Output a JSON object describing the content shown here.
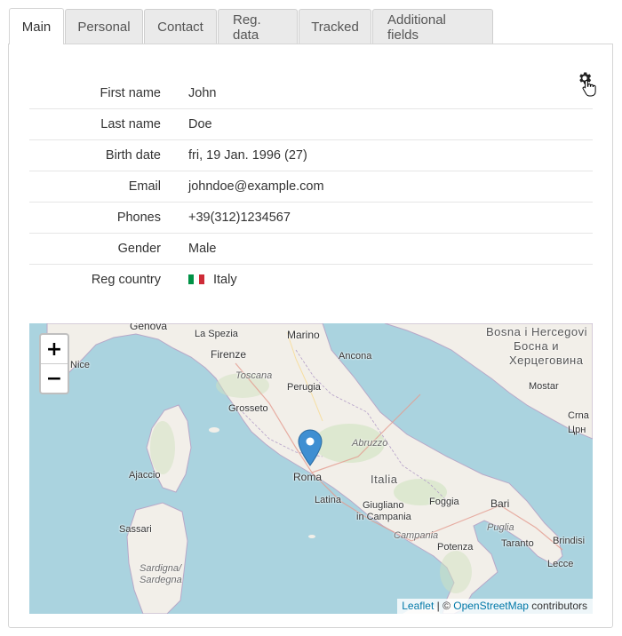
{
  "tabs": [
    "Main",
    "Personal",
    "Contact",
    "Reg. data",
    "Tracked",
    "Additional fields"
  ],
  "fields": [
    {
      "label": "First name",
      "value": "John"
    },
    {
      "label": "Last name",
      "value": "Doe"
    },
    {
      "label": "Birth date",
      "value": "fri, 19 Jan. 1996 (27)"
    },
    {
      "label": "Email",
      "value": "johndoe@example.com"
    },
    {
      "label": "Phones",
      "value": "+39(312)1234567"
    },
    {
      "label": "Gender",
      "value": "Male"
    },
    {
      "label": "Reg country",
      "value": "Italy"
    }
  ],
  "flag_colors": [
    "#009246",
    "#ffffff",
    "#ce2b37"
  ],
  "icons": {
    "settings": "gear-icon",
    "cursor": "hand-pointer-icon",
    "marker": "map-marker-icon"
  },
  "map": {
    "zoom_in": "+",
    "zoom_out": "−",
    "attribution": {
      "leaflet": "Leaflet",
      "sep": " | © ",
      "osm": "OpenStreetMap",
      "suffix": " contributors"
    },
    "marker_color": "#3f8fd2",
    "labels": {
      "genova": "Genova",
      "laspezia": "La Spezia",
      "marino": "Marino",
      "nice": "Nice",
      "firenze": "Firenze",
      "toscana": "Toscana",
      "ancona": "Ancona",
      "perugia": "Perugia",
      "grosseto": "Grosseto",
      "abruzzo": "Abruzzo",
      "roma": "Roma",
      "italia": "Italia",
      "ajaccio": "Ajaccio",
      "latina": "Latina",
      "foggia": "Foggia",
      "bari": "Bari",
      "giugliano1": "Giugliano",
      "giugliano2": "in Campania",
      "campania": "Campania",
      "puglia": "Puglia",
      "taranto": "Taranto",
      "brindisi": "Brindisi",
      "sassari": "Sassari",
      "potenza": "Potenza",
      "lecce": "Lecce",
      "sardegna1": "Sardigna/",
      "sardegna2": "Sardegna",
      "bosna1": "Bosna i Hercegovi",
      "bosna2": "Босна и",
      "bosna3": "Херцеговина",
      "mostar": "Mostar",
      "crna1": "Crna",
      "crna2": "Црн"
    }
  }
}
